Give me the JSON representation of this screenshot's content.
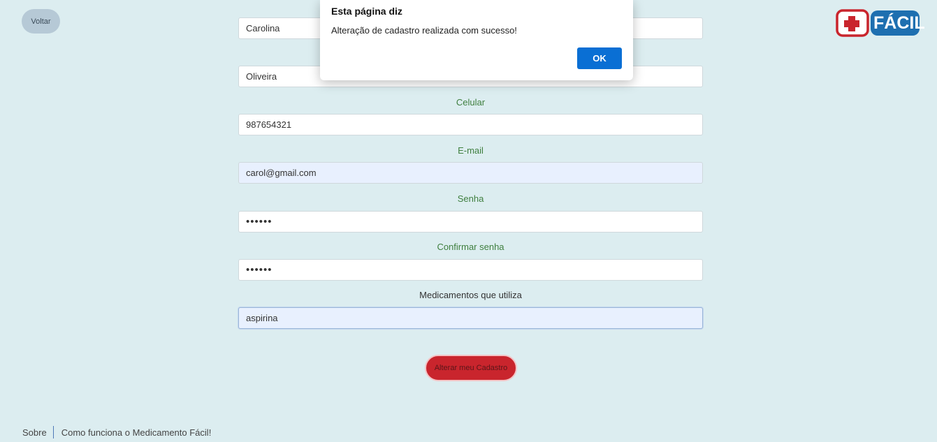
{
  "header": {
    "back_label": "Voltar",
    "logo_text": "FÁCIL",
    "logo_colors": {
      "red": "#c9252d",
      "blue": "#1e6fb0"
    }
  },
  "form": {
    "first_name_value": "Carolina",
    "last_name_value": "Oliveira",
    "phone_label": "Celular",
    "phone_value": "987654321",
    "email_label": "E-mail",
    "email_value": "carol@gmail.com",
    "password_label": "Senha",
    "password_value": "••••••",
    "confirm_label": "Confirmar senha",
    "confirm_value": "••••••",
    "meds_label": "Medicamentos que utiliza",
    "meds_value": "aspirina",
    "submit_label": "Alterar meu Cadastro"
  },
  "footer": {
    "about_label": "Sobre",
    "how_label": "Como funciona o Medicamento Fácil!"
  },
  "dialog": {
    "title": "Esta página diz",
    "message": "Alteração de cadastro realizada com sucesso!",
    "ok_label": "OK"
  },
  "colors": {
    "background": "#dcedf0",
    "label_green": "#3f7f3f",
    "submit_red": "#c9252d",
    "ok_blue": "#0a6fd4"
  }
}
